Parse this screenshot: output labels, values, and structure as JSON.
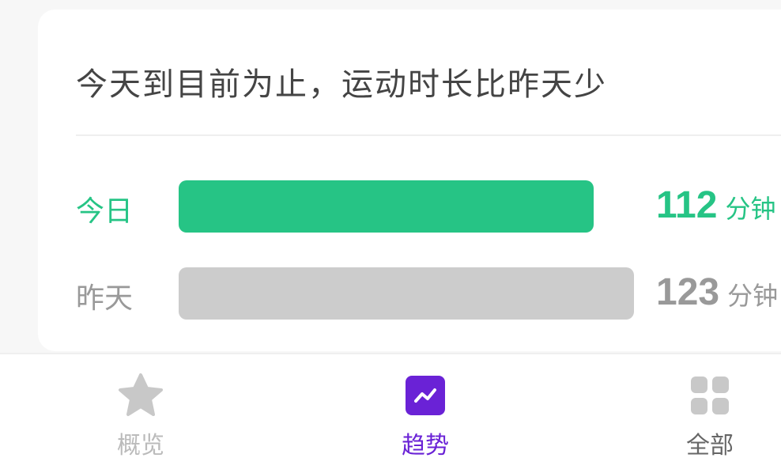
{
  "summary": {
    "headline": "今天到目前为止，运动时长比昨天少"
  },
  "comparison": [
    {
      "label": "今日",
      "value": "112",
      "unit": "分钟",
      "fraction": 0.911,
      "color": "#26c485"
    },
    {
      "label": "昨天",
      "value": "123",
      "unit": "分钟",
      "fraction": 1.0,
      "color": "#cccccc"
    }
  ],
  "tabs": [
    {
      "label": "概览",
      "icon": "star-icon",
      "active": false
    },
    {
      "label": "趋势",
      "icon": "trend-icon",
      "active": true
    },
    {
      "label": "全部",
      "icon": "grid-icon",
      "active": false
    }
  ],
  "colors": {
    "accent_green": "#26c485",
    "accent_purple": "#6a22d6",
    "muted_text": "#999999"
  }
}
